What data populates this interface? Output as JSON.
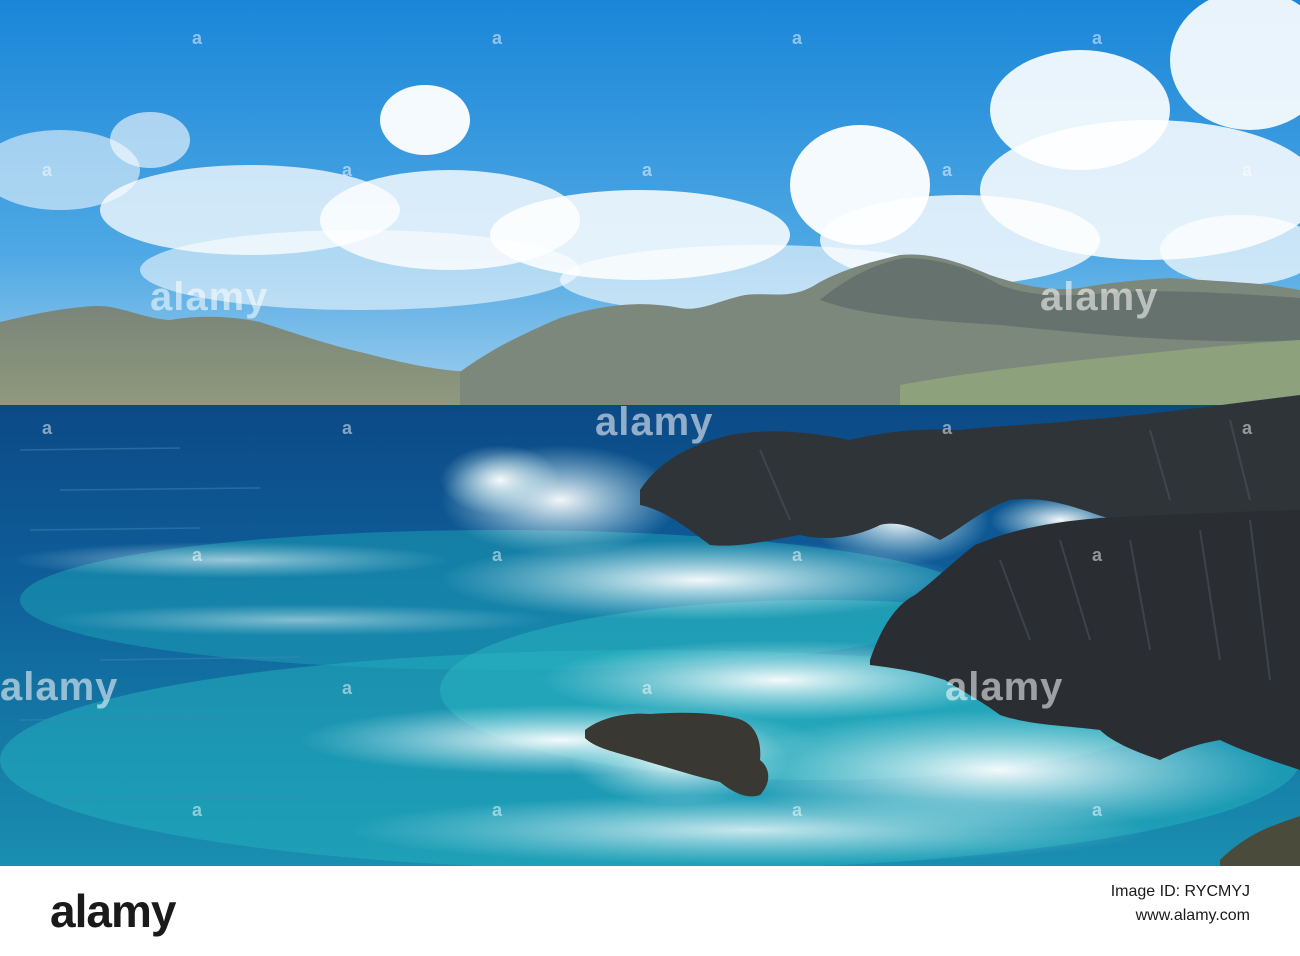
{
  "photo": {
    "description_icon": "landscape-photo",
    "colors": {
      "sky_top": "#1e88d6",
      "sky_bottom": "#8cc8ee",
      "mountain": "#7d8a7e",
      "mountain_shadow": "#5a6764",
      "sea_deep": "#0c4f8c",
      "sea_turquoise": "#1fa8b8",
      "foam": "#e8f7f8",
      "rock": "#2e3236"
    }
  },
  "watermark": {
    "text": "alamy",
    "letter": "a"
  },
  "footer": {
    "logo": "alamy",
    "image_id_label": "Image ID: RYCMYJ",
    "site": "www.alamy.com"
  }
}
